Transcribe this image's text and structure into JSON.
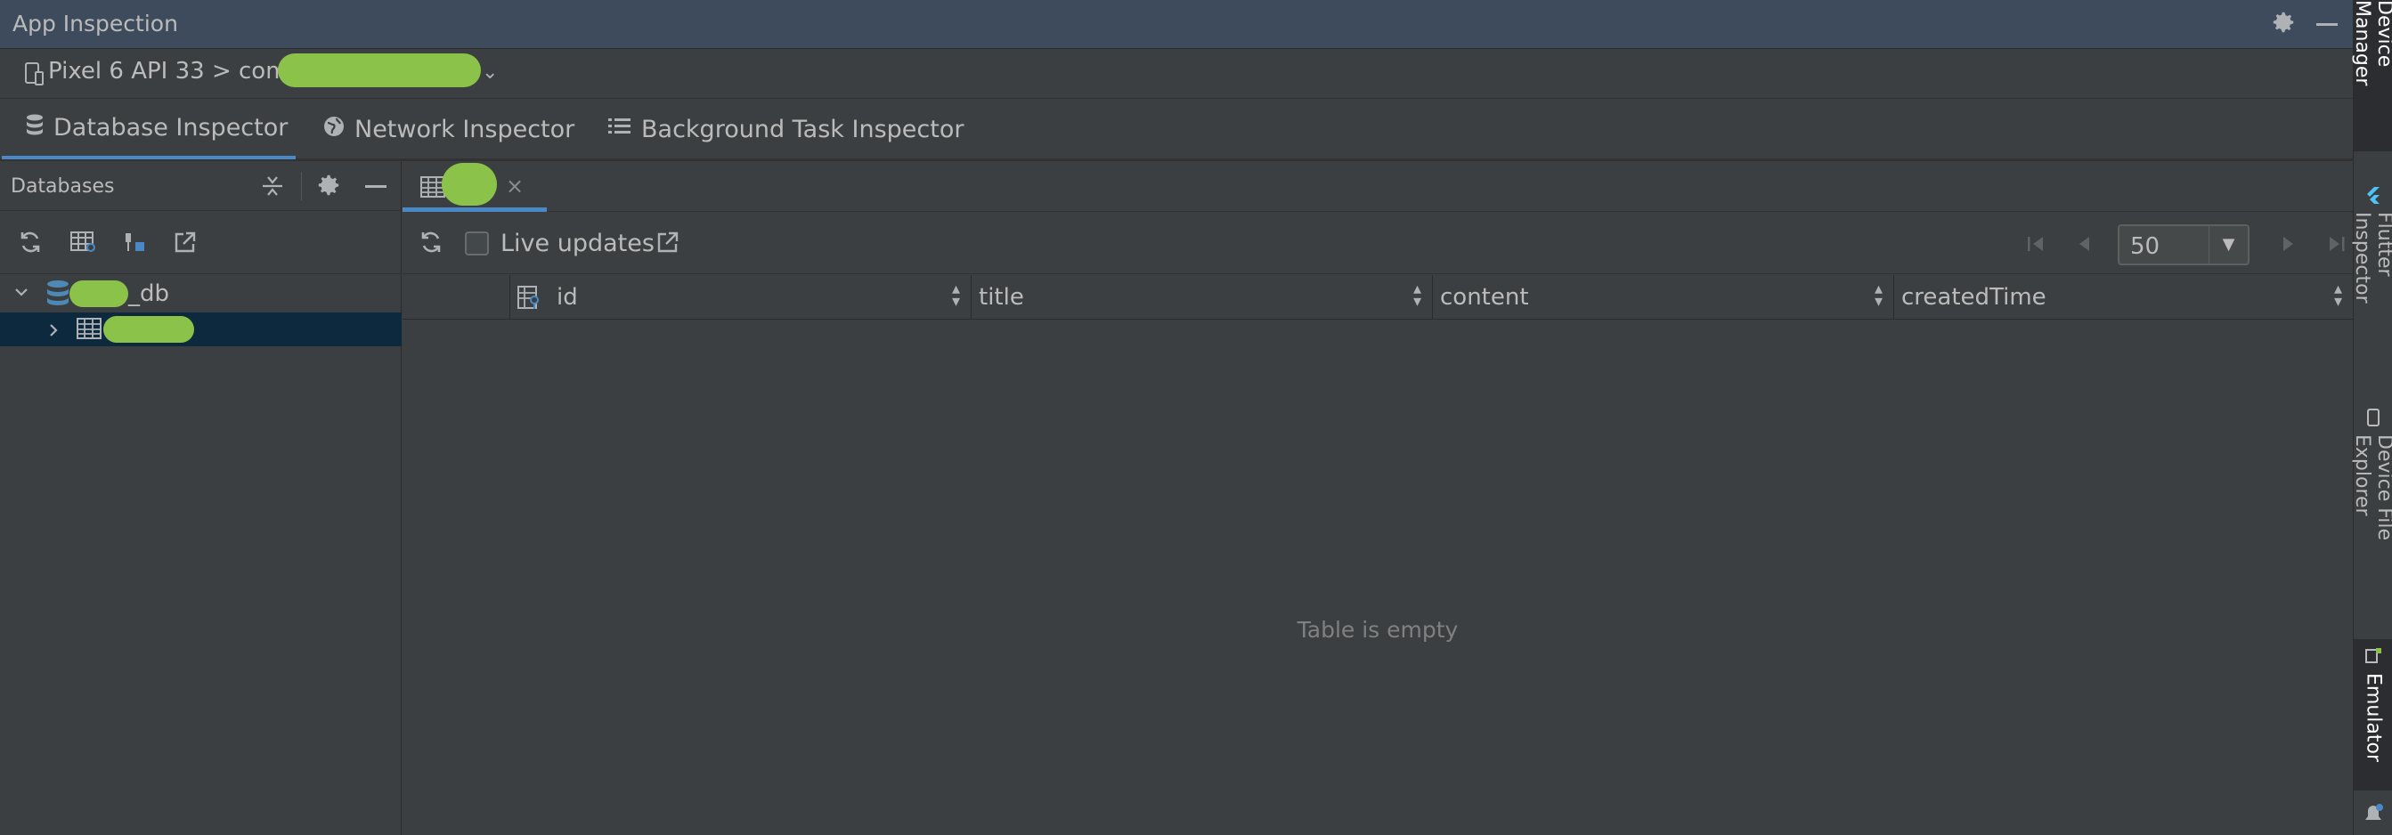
{
  "app": {
    "title": "App Inspection"
  },
  "device": {
    "label": "Pixel 6 API 33 > com"
  },
  "tabs": [
    {
      "label": "Database Inspector"
    },
    {
      "label": "Network Inspector"
    },
    {
      "label": "Background Task Inspector"
    }
  ],
  "databases": {
    "title": "Databases",
    "db_suffix": "_db"
  },
  "toolbar": {
    "live_updates_label": "Live updates",
    "page_size": "50"
  },
  "table": {
    "columns": [
      {
        "name": "id"
      },
      {
        "name": "title"
      },
      {
        "name": "content"
      },
      {
        "name": "createdTime"
      }
    ],
    "empty_text": "Table is empty"
  },
  "right_sidebar": {
    "tabs": [
      {
        "label": "Device Manager"
      },
      {
        "label": "Flutter Inspector"
      },
      {
        "label": "Device File Explorer"
      },
      {
        "label": "Emulator"
      }
    ]
  },
  "colors": {
    "accent": "#4a88c7",
    "redaction": "#8bc34a",
    "titlebar": "#3d4b5c",
    "selection": "#0d293e"
  }
}
